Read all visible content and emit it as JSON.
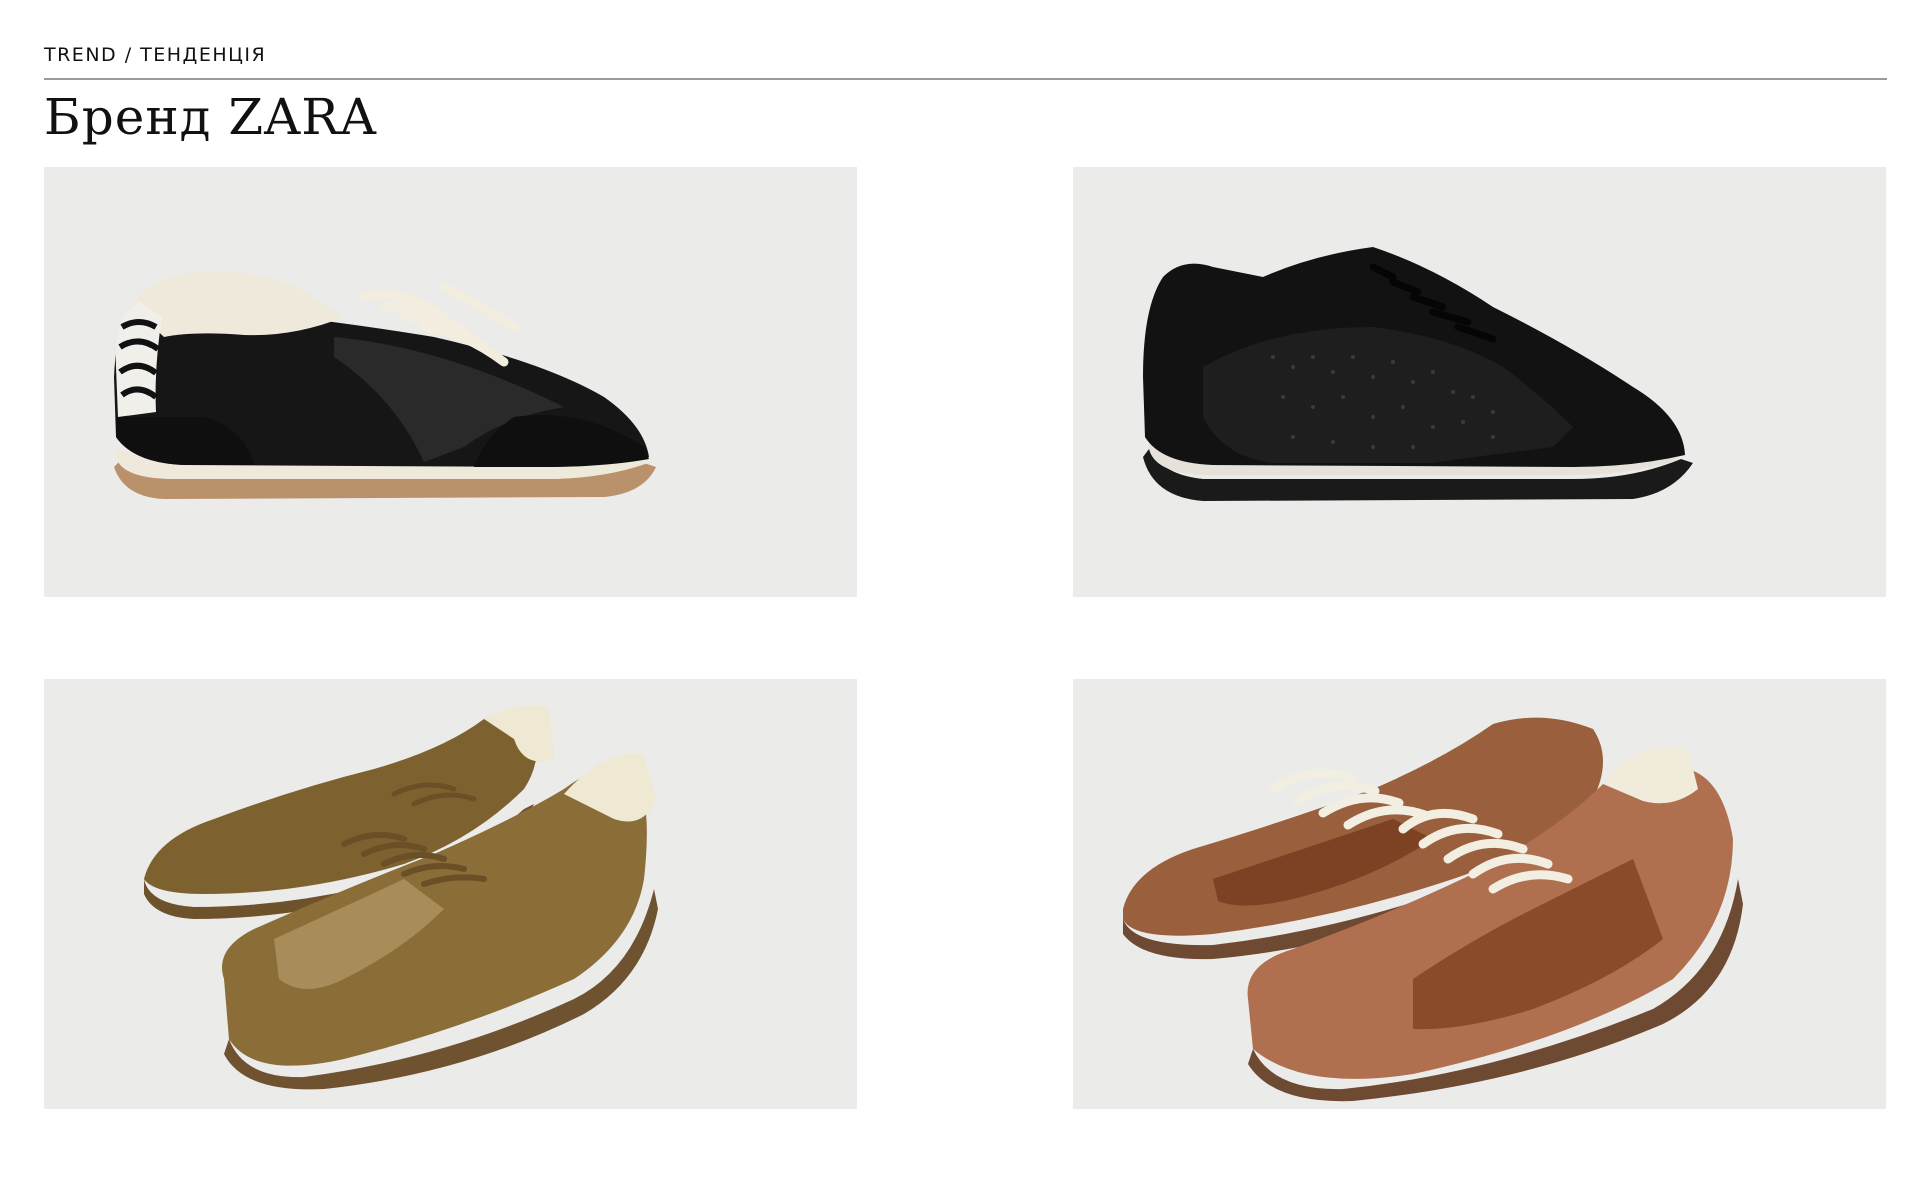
{
  "header": {
    "eyebrow": "TREND / ТЕНДЕНЦІЯ",
    "title": "Бренд ZARA"
  },
  "products": [
    {
      "id": "sneaker-black-zebra",
      "icon": "sneaker-icon",
      "colors": {
        "upper": "#141414",
        "sole": "#b9916b",
        "accent": "#efe9dc"
      }
    },
    {
      "id": "sneaker-black-rhinestone",
      "icon": "sneaker-icon",
      "colors": {
        "upper": "#111111",
        "sole": "#1a1a1a",
        "accent": "#e6e2da"
      }
    },
    {
      "id": "sneaker-khaki-pair",
      "icon": "sneaker-pair-icon",
      "colors": {
        "upper": "#8a6d37",
        "sole": "#7a5a35",
        "accent": "#f3ecd8"
      }
    },
    {
      "id": "sneaker-brown-suede-pair",
      "icon": "sneaker-pair-icon",
      "colors": {
        "upper": "#a8684a",
        "sole": "#6f4a33",
        "accent": "#f4efe3"
      }
    }
  ]
}
